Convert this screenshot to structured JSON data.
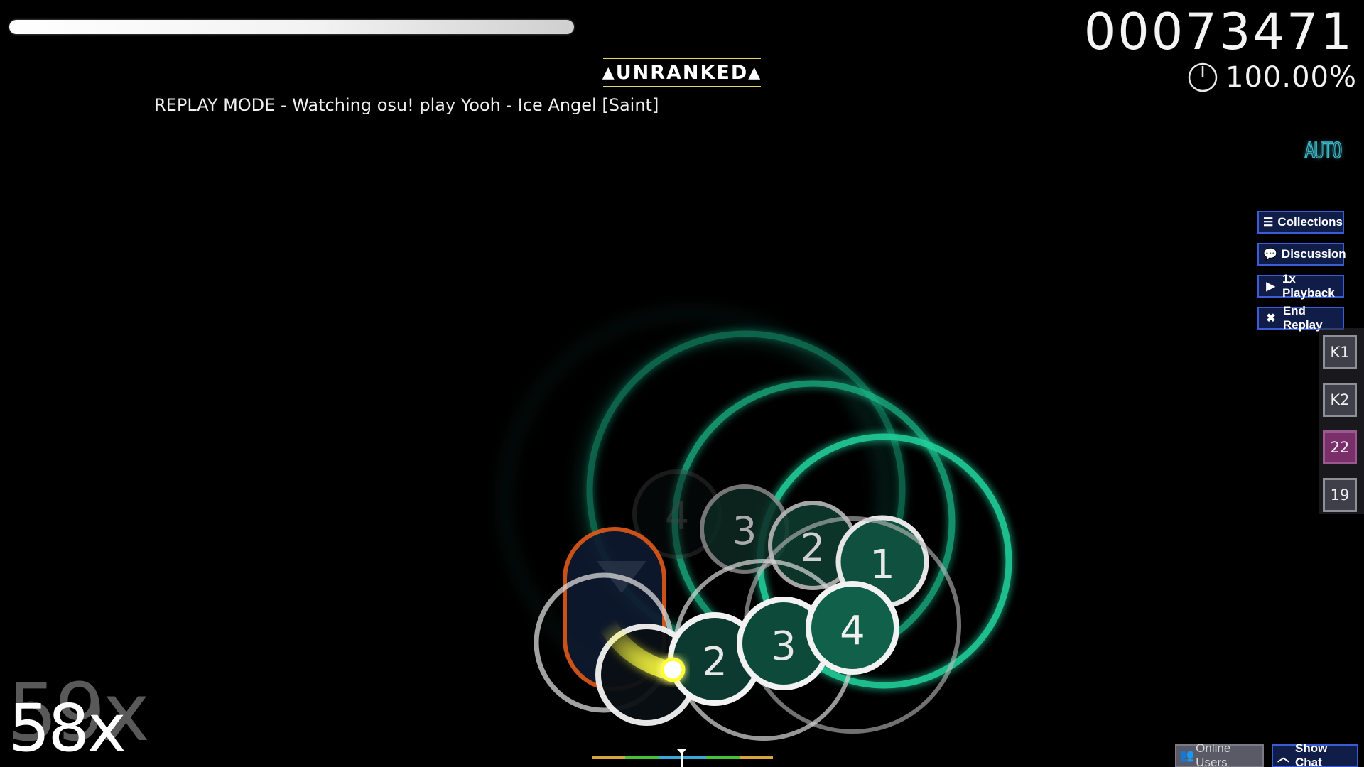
{
  "hud": {
    "score": "00073471",
    "accuracy": "100.00%",
    "combo": "58x",
    "combo_ghost": "59x",
    "health_fraction": 1.0
  },
  "banner": {
    "unranked_label": "UNRANKED",
    "replay_text": "REPLAY MODE - Watching osu! play Yooh - Ice Angel [Saint]"
  },
  "mod": {
    "label": "AUTO"
  },
  "side_buttons": {
    "collections": "Collections",
    "discussion": "Discussion",
    "playback": "1x Playback",
    "end_replay": "End Replay"
  },
  "keys": {
    "k1": "K1",
    "k2": "K2",
    "m1": "22",
    "m2": "19"
  },
  "bottom": {
    "online_users": "Online Users",
    "show_chat": "Show Chat"
  },
  "hit_objects": {
    "numbers": [
      "1",
      "2",
      "3",
      "4",
      "2",
      "3",
      "1"
    ]
  },
  "colors": {
    "approach": "#20c090",
    "slider_border": "#e05a1a",
    "button_border": "#3a5dd6",
    "button_bg": "#0f1d48",
    "unranked_line": "#e3d766",
    "key_m1": "#7a2f6b"
  },
  "icons": {
    "warning": "warning-icon",
    "collections": "list-icon",
    "discussion": "speech-bubble-icon",
    "playback": "play-icon",
    "end_replay": "close-icon",
    "online_users": "users-icon",
    "show_chat": "chevron-up-icon",
    "accuracy": "pie-timer-icon"
  }
}
